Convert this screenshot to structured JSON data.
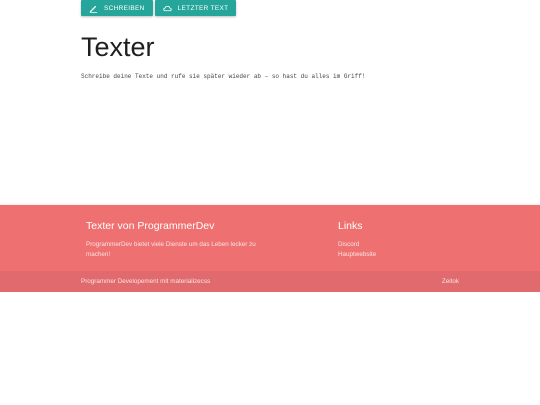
{
  "toolbar": {
    "write_label": "SCHREIBEN",
    "write_icon": "pencil-icon",
    "last_label": "LETZTER TEXT",
    "last_icon": "cloud-icon"
  },
  "main": {
    "title": "Texter",
    "subtitle": "Schreibe deine Texte und rufe sie später wieder ab – so hast du alles im Griff!"
  },
  "footer": {
    "heading": "Texter von ProgrammerDev",
    "description": "ProgrammerDev bietet viele Dienste um das Leben lecker zu machen!",
    "links_heading": "Links",
    "links": [
      "Discord",
      "Hauptwebsite"
    ],
    "copyright": "Programmer Developement mit materializecss",
    "right_link": "Zeitok"
  },
  "colors": {
    "button": "#26a69a",
    "footer": "#ef7070",
    "footer_bottom": "#e06a6d"
  }
}
